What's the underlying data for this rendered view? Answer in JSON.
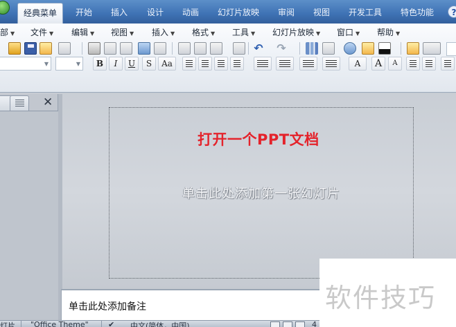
{
  "ribbon_tabs": [
    "经典菜单",
    "开始",
    "插入",
    "设计",
    "动画",
    "幻灯片放映",
    "审阅",
    "视图",
    "开发工具",
    "特色功能"
  ],
  "active_tab": "经典菜单",
  "help_icon": "help-icon",
  "classic_menus": [
    "部",
    "文件",
    "编辑",
    "视图",
    "插入",
    "格式",
    "工具",
    "幻灯片放映",
    "窗口",
    "帮助"
  ],
  "toolbar_icons": [
    "open-folder-icon",
    "save-icon",
    "permission-icon",
    "print-preview-icon",
    "print-icon",
    "preview-icon",
    "spelling-icon",
    "research-icon",
    "cut-icon",
    "copy-icon",
    "paste-icon",
    "format-painter-icon",
    "undo-icon",
    "redo-icon",
    "chart-icon",
    "table-icon",
    "insert-picture-icon",
    "color-icon",
    "new-slide-icon"
  ],
  "format_buttons": {
    "bold": "B",
    "italic": "I",
    "underline": "U",
    "shadow": "S",
    "change_case": "Aa",
    "font_color": "A",
    "grow_font": "A",
    "shrink_font": "A"
  },
  "left_panel": {
    "close_glyph": "✕"
  },
  "slide": {
    "annotation": "打开一个PPT文档",
    "annotation_color": "#e4232b",
    "title_placeholder": "单击此处添加第一张幻灯片"
  },
  "notes": {
    "placeholder": "单击此处添加备注"
  },
  "status_bar": {
    "slide": "灯片",
    "theme": "\"Office Theme\"",
    "language": "中文(简体，中国)",
    "zoom": "4"
  },
  "watermark": {
    "text": "软件技巧"
  }
}
